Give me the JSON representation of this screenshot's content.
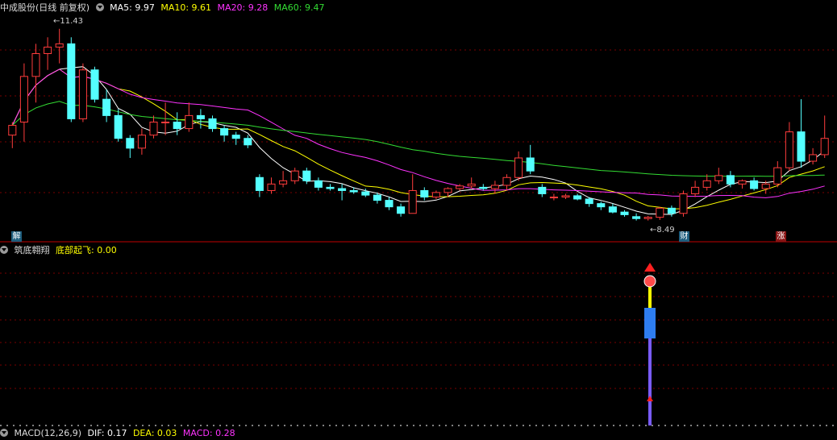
{
  "main_panel": {
    "title": "中成股份(日线 前复权)",
    "indicators": [
      {
        "label": "MA5:",
        "value": "9.97",
        "color": "#ffffff"
      },
      {
        "label": "MA10:",
        "value": "9.61",
        "color": "#ffff00"
      },
      {
        "label": "MA20:",
        "value": "9.28",
        "color": "#ff33ff"
      },
      {
        "label": "MA60:",
        "value": "9.47",
        "color": "#33dd33"
      }
    ],
    "high_label": "11.43",
    "low_label": "8.49",
    "badges": [
      {
        "text": "解",
        "color": "#1e5e7e"
      },
      {
        "text": "财",
        "color": "#1e5e7e"
      },
      {
        "text": "涨",
        "color": "#8a1414"
      }
    ]
  },
  "sub_panel": {
    "title": "筑底翱翔",
    "indicator_label": "底部起飞:",
    "indicator_value": "0.00",
    "indicator_color": "#ffff00"
  },
  "bottom_panel": {
    "title": "MACD(12,26,9)",
    "items": [
      {
        "label": "DIF:",
        "value": "0.17",
        "color": "#ffffff"
      },
      {
        "label": "DEA:",
        "value": "0.03",
        "color": "#ffff00"
      },
      {
        "label": "MACD:",
        "value": "0.28",
        "color": "#ff33ff"
      }
    ]
  },
  "colors": {
    "up": "#ff3c3c",
    "down": "#54ffff",
    "grid": "#7a0000",
    "divider": "#c00000"
  },
  "chart_data": {
    "type": "candlestick",
    "ohlc": [
      [
        9.8,
        10.0,
        9.6,
        9.95
      ],
      [
        10.0,
        10.9,
        9.7,
        10.7
      ],
      [
        10.7,
        11.2,
        10.3,
        11.05
      ],
      [
        11.05,
        11.3,
        10.8,
        11.15
      ],
      [
        11.15,
        11.43,
        10.9,
        11.2
      ],
      [
        11.2,
        11.3,
        10.0,
        10.05
      ],
      [
        10.05,
        10.9,
        10.0,
        10.8
      ],
      [
        10.8,
        10.85,
        10.3,
        10.35
      ],
      [
        10.35,
        10.5,
        10.0,
        10.1
      ],
      [
        10.1,
        10.2,
        9.7,
        9.75
      ],
      [
        9.75,
        9.8,
        9.45,
        9.6
      ],
      [
        9.6,
        9.9,
        9.5,
        9.8
      ],
      [
        9.8,
        10.1,
        9.75,
        10.0
      ],
      [
        10.0,
        10.3,
        9.8,
        10.0
      ],
      [
        10.0,
        10.15,
        9.8,
        9.9
      ],
      [
        9.9,
        10.3,
        9.85,
        10.1
      ],
      [
        10.1,
        10.2,
        9.9,
        10.05
      ],
      [
        10.05,
        10.1,
        9.85,
        9.9
      ],
      [
        9.9,
        9.95,
        9.7,
        9.8
      ],
      [
        9.8,
        9.85,
        9.65,
        9.75
      ],
      [
        9.75,
        9.8,
        9.6,
        9.65
      ],
      [
        9.15,
        9.2,
        8.85,
        8.95
      ],
      [
        8.95,
        9.15,
        8.9,
        9.05
      ],
      [
        9.05,
        9.25,
        9.0,
        9.1
      ],
      [
        9.1,
        9.3,
        9.05,
        9.25
      ],
      [
        9.25,
        9.3,
        9.05,
        9.1
      ],
      [
        9.1,
        9.15,
        8.95,
        9.0
      ],
      [
        9.0,
        9.05,
        8.95,
        8.98
      ],
      [
        8.98,
        9.05,
        8.8,
        8.95
      ],
      [
        8.95,
        9.0,
        8.9,
        8.93
      ],
      [
        8.93,
        8.98,
        8.85,
        8.88
      ],
      [
        8.88,
        8.92,
        8.75,
        8.8
      ],
      [
        8.8,
        8.85,
        8.65,
        8.7
      ],
      [
        8.7,
        8.75,
        8.55,
        8.6
      ],
      [
        8.6,
        9.2,
        8.6,
        8.95
      ],
      [
        8.95,
        9.0,
        8.8,
        8.85
      ],
      [
        8.85,
        8.95,
        8.82,
        8.92
      ],
      [
        8.92,
        9.0,
        8.85,
        8.98
      ],
      [
        8.98,
        9.05,
        8.95,
        9.02
      ],
      [
        9.02,
        9.15,
        8.98,
        9.05
      ],
      [
        9.0,
        9.05,
        8.95,
        8.98
      ],
      [
        8.98,
        9.1,
        8.9,
        9.03
      ],
      [
        9.03,
        9.2,
        8.95,
        9.15
      ],
      [
        9.15,
        9.55,
        9.1,
        9.45
      ],
      [
        9.45,
        9.65,
        9.2,
        9.25
      ],
      [
        9.0,
        9.05,
        8.85,
        8.9
      ],
      [
        8.85,
        8.9,
        8.8,
        8.85
      ],
      [
        8.85,
        8.9,
        8.82,
        8.87
      ],
      [
        8.87,
        8.9,
        8.8,
        8.82
      ],
      [
        8.82,
        8.85,
        8.7,
        8.75
      ],
      [
        8.75,
        8.78,
        8.65,
        8.7
      ],
      [
        8.7,
        8.75,
        8.6,
        8.62
      ],
      [
        8.62,
        8.65,
        8.55,
        8.58
      ],
      [
        8.55,
        8.6,
        8.49,
        8.52
      ],
      [
        8.52,
        8.56,
        8.49,
        8.54
      ],
      [
        8.54,
        8.7,
        8.5,
        8.68
      ],
      [
        8.68,
        8.72,
        8.55,
        8.6
      ],
      [
        8.6,
        8.95,
        8.55,
        8.9
      ],
      [
        8.9,
        9.1,
        8.85,
        9.0
      ],
      [
        9.0,
        9.2,
        8.95,
        9.1
      ],
      [
        9.1,
        9.3,
        9.05,
        9.18
      ],
      [
        9.18,
        9.25,
        9.0,
        9.05
      ],
      [
        9.05,
        9.12,
        8.98,
        9.1
      ],
      [
        9.1,
        9.15,
        8.95,
        8.98
      ],
      [
        8.98,
        9.1,
        8.9,
        9.05
      ],
      [
        9.05,
        9.4,
        9.0,
        9.3
      ],
      [
        9.3,
        10.0,
        9.25,
        9.85
      ],
      [
        9.85,
        10.35,
        9.3,
        9.4
      ],
      [
        9.4,
        9.6,
        9.35,
        9.5
      ],
      [
        9.5,
        10.1,
        9.45,
        9.75
      ]
    ]
  }
}
